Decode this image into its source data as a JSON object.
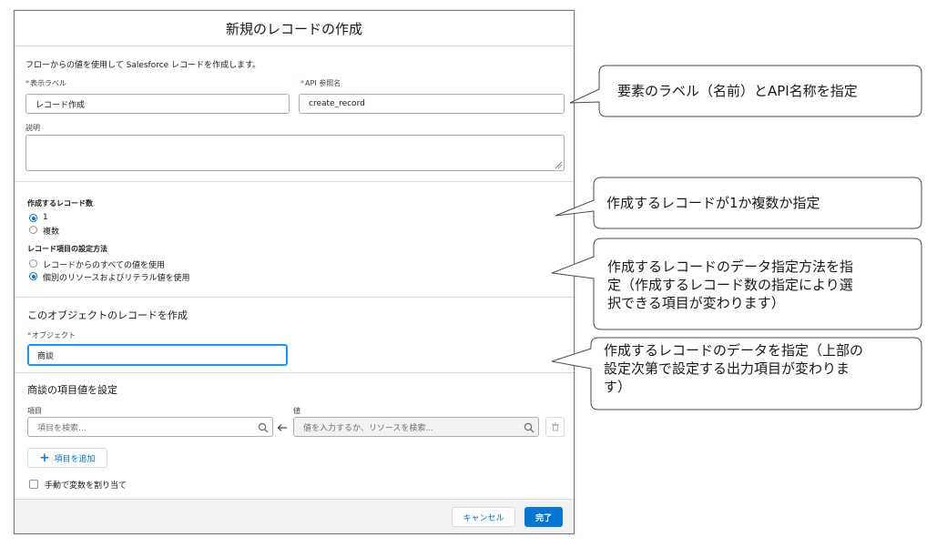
{
  "modal": {
    "title": "新規のレコードの作成",
    "intro": "フローからの値を使用して Salesforce レコードを作成します。",
    "display_label": {
      "label": "表示ラベル",
      "value": "レコード作成"
    },
    "api_name": {
      "label": "API 参照名",
      "value": "create_record"
    },
    "description": {
      "label": "説明",
      "value": ""
    },
    "record_count": {
      "label": "作成するレコード数",
      "options": [
        {
          "label": "1",
          "checked": true
        },
        {
          "label": "複数",
          "checked": false
        }
      ]
    },
    "field_method": {
      "label": "レコード項目の設定方法",
      "options": [
        {
          "label": "レコードからのすべての値を使用",
          "checked": false
        },
        {
          "label": "個別のリソースおよびリテラル値を使用",
          "checked": true
        }
      ]
    },
    "object_section": {
      "title": "このオブジェクトのレコードを作成",
      "object_label": "オブジェクト",
      "object_value": "商談"
    },
    "field_values": {
      "title": "商談の項目値を設定",
      "field_col_label": "項目",
      "value_col_label": "値",
      "field_placeholder": "項目を検索...",
      "value_placeholder": "値を入力するか、リソースを検索...",
      "add_field_label": "項目を追加",
      "manual_assign_label": "手動で変数を割り当て"
    },
    "footer": {
      "cancel_label": "キャンセル",
      "done_label": "完了"
    }
  },
  "callouts": [
    {
      "lines": [
        "要素のラベル（名前）とAPI名称を指定"
      ]
    },
    {
      "lines": [
        "作成するレコードが1か複数か指定"
      ]
    },
    {
      "lines": [
        "作成するレコードのデータ指定方法を指",
        "定（作成するレコード数の指定により選",
        "択できる項目が変わります）"
      ]
    },
    {
      "lines": [
        "作成するレコードのデータを指定（上部の",
        "設定次第で設定する出力項目が変わりま",
        "す）"
      ]
    }
  ],
  "colors": {
    "brand": "#0176d3",
    "focus": "#1b96ff",
    "required": "#c23934"
  },
  "icons": [
    "search-icon",
    "left-arrow-icon",
    "delete-icon",
    "add-icon",
    "resize-handle-icon"
  ]
}
